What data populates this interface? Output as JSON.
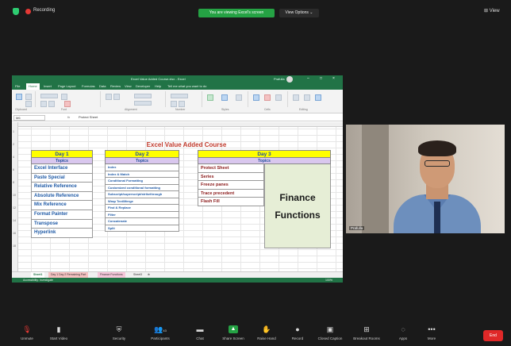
{
  "meeting": {
    "recording_label": "Recording",
    "share_banner": "You are viewing Excel's screen",
    "view_options": "View Options",
    "view_label": "View"
  },
  "excel": {
    "title": "Excel Value Added Course.xlsx - Excel",
    "user": "Prafulla",
    "ribbon_tabs": [
      "File",
      "Home",
      "Insert",
      "Page Layout",
      "Formulas",
      "Data",
      "Review",
      "View",
      "Developer",
      "Help",
      "Tell me what you want to do"
    ],
    "ribbon_groups": [
      "Clipboard",
      "Font",
      "Alignment",
      "Number",
      "Styles",
      "Cells",
      "Editing"
    ],
    "name_box": "M6",
    "formula": "Protect Sheet",
    "course_title": "Excel Value Added Course",
    "day1": {
      "heading": "Day 1",
      "topics_label": "Topics",
      "items": [
        "Excel Interface",
        "Paste Special",
        "Relative Reference",
        "Absolute Reference",
        "Mix Reference",
        "Format Painter",
        "Transpose",
        "Hyperlink"
      ]
    },
    "day2": {
      "heading": "Day 2",
      "topics_label": "Topics",
      "items": [
        "Index",
        "Index & Match",
        "Conditional Formatting",
        "Customized conditional formatting",
        "Subscript/superscript/strikethrough",
        "Wrap Text/Merge",
        "Find & Replace",
        "Filter",
        "Concatenate",
        "Split"
      ]
    },
    "day3": {
      "heading": "Day 3",
      "topics_label": "Topics",
      "items": [
        "Protect Sheet",
        "Series",
        "Freeze panes",
        "Trace precedent",
        "Flash Fill"
      ],
      "finance_line1": "Finance",
      "finance_line2": "Functions"
    },
    "sheets": [
      "Sheet1",
      "Day 1 Day 2 Remaining Part",
      "Finance Functions",
      "Sheet3"
    ],
    "status": "Accessibility: Investigate",
    "zoom": "100%"
  },
  "video": {
    "participant_name": "Prafulla"
  },
  "toolbar": {
    "items": [
      "Unmute",
      "Start Video",
      "Security",
      "Participants",
      "Chat",
      "Share Screen",
      "Raise Hand",
      "Record",
      "Closed Caption",
      "Breakout Rooms",
      "Apps",
      "More"
    ],
    "participants_count": "43",
    "end_label": "End"
  }
}
